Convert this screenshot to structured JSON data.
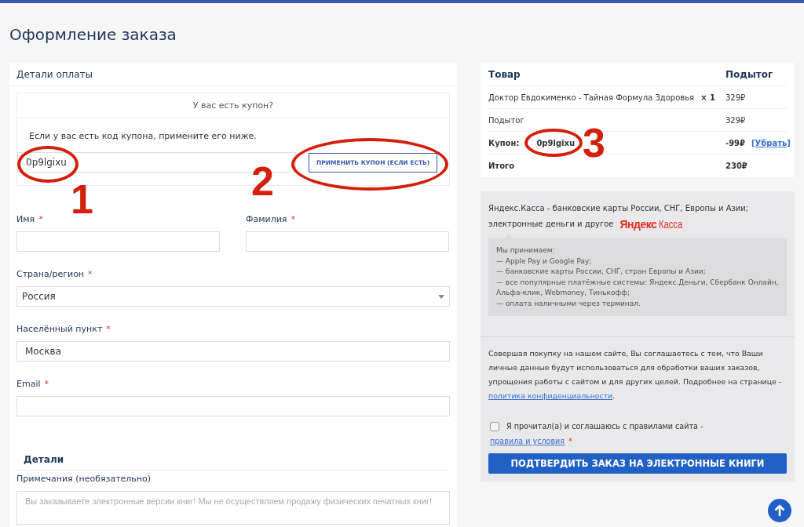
{
  "page_title": "Оформление заказа",
  "billing": {
    "title": "Детали оплаты",
    "coupon": {
      "toggle": "У вас есть купон?",
      "hint": "Если у вас есть код купона, примените его ниже.",
      "value": "0p9lgixu",
      "button": "ПРИМЕНИТЬ КУПОН (ЕСЛИ ЕСТЬ)"
    },
    "name_fields": [
      {
        "label": "Имя",
        "required_mark": "*",
        "kind": "text"
      },
      {
        "label": "Фамилия",
        "required_mark": "*",
        "kind": "text"
      }
    ],
    "fields": [
      {
        "label": "Страна/регион",
        "required_mark": "*",
        "kind": "select",
        "value": "Россия"
      },
      {
        "label": "Населённый пункт",
        "required_mark": "*",
        "kind": "text",
        "value": "Москва"
      },
      {
        "label": "Email",
        "required_mark": "*",
        "kind": "text"
      }
    ],
    "details": {
      "title": "Детали",
      "notes_label": "Примечания (необязательно)",
      "notes_placeholder": "Вы заказываете электронные версии книг! Мы не осуществляем продажу физических печатных книг!"
    }
  },
  "order": {
    "columns": [
      "Товар",
      "Подытог"
    ],
    "rows": [
      {
        "kind": "item",
        "label": "Доктор Евдокименко - Тайная Формула Здоровья",
        "qty": "× 1",
        "value": "329₽"
      },
      {
        "kind": "subtotal",
        "label": "Подытог",
        "value": "329₽"
      },
      {
        "kind": "coupon",
        "label": "Купон:",
        "code": "0p9lgixu",
        "value": "-99₽",
        "action": "[Убрать]"
      },
      {
        "kind": "total",
        "label": "Итого",
        "value": "230₽"
      }
    ]
  },
  "payment": {
    "method_lines": [
      "Яндекс.Касса - банковские карты России, СНГ, Европы и Азии;",
      "электронные деньги и другое"
    ],
    "logo": {
      "brand": "Яндекс",
      "product": "Касса"
    },
    "accept_lines": [
      "Мы принимаем:",
      "— Apple Pay и Google Pay;",
      "— банковские карты России, СНГ, стран Европы и Азии;",
      "— все популярные платёжные системы: Яндекс.Деньги, Сбербанк Онлайн, Альфа-клик, Webmoney, Тинькофф;",
      "— оплата наличными через терминал."
    ],
    "privacy_text": "Совершая покупку на нашем сайте, Вы соглашаетесь с тем, что Ваши личные данные будут использоваться для обработки ваших заказов, упрощения работы с сайтом и для других целей. Подробнее на странице - ",
    "privacy_link": "политика конфиденциальности",
    "privacy_end": ".",
    "terms": {
      "checked": false,
      "text": "Я прочитал(а) и соглашаюсь с правилами сайта - ",
      "link": "правила и условия",
      "required_mark": "*"
    },
    "submit": "ПОДТВЕРДИТЬ ЗАКАЗ НА ЭЛЕКТРОННЫЕ КНИГИ"
  },
  "annotations": [
    {
      "label": "1"
    },
    {
      "label": "2"
    },
    {
      "label": "3"
    }
  ]
}
